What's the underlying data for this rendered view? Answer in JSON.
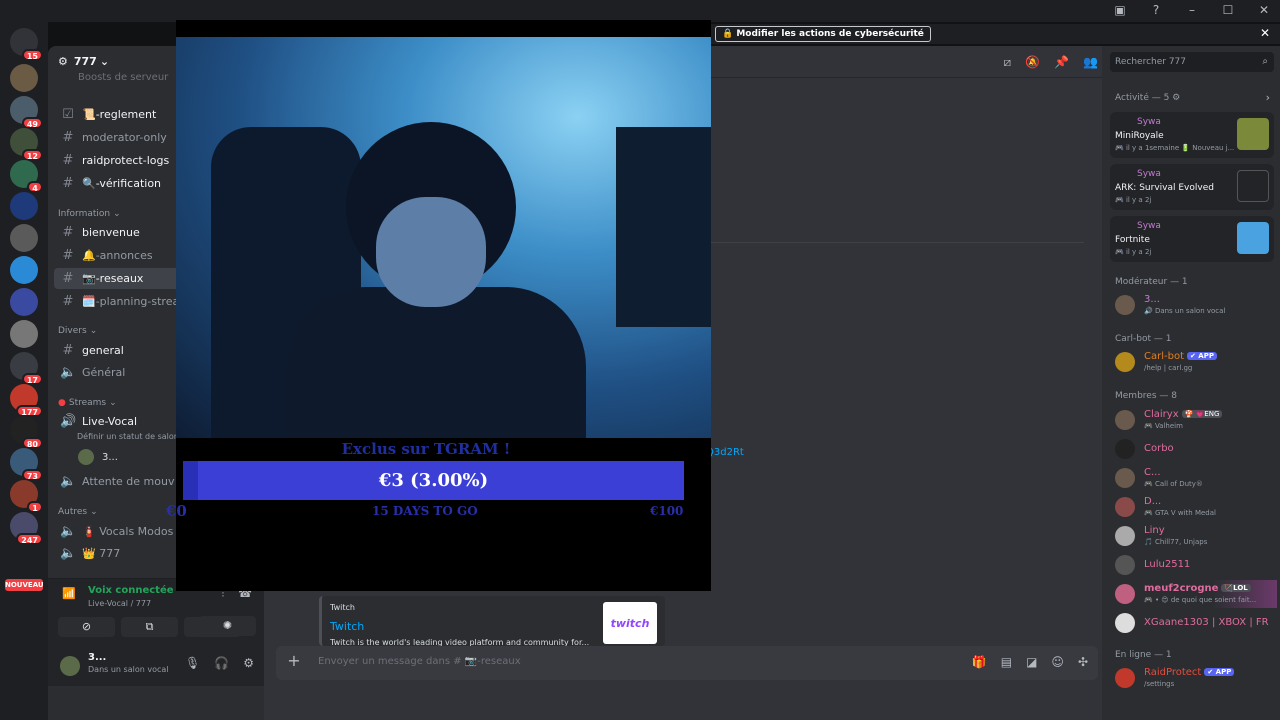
{
  "server": {
    "name": "777",
    "boosts_label": "Boosts de serveur"
  },
  "channels": {
    "top": [
      {
        "label": "📜-reglement",
        "bright": true
      },
      {
        "label": "moderator-only",
        "bright": false
      },
      {
        "label": "raidprotect-logs",
        "bright": true
      },
      {
        "label": "🔍-vérification",
        "bright": true
      }
    ],
    "cat_information": "Information",
    "information": [
      {
        "label": "bienvenue",
        "bright": true
      },
      {
        "label": "🔔-annonces",
        "bright": false
      },
      {
        "label": "📷-reseaux",
        "bright": true,
        "selected": true
      },
      {
        "label": "🗓️-planning-streams",
        "bright": false
      }
    ],
    "cat_divers": "Divers",
    "divers": [
      {
        "label": "general",
        "bright": true
      },
      {
        "label": "Général",
        "bright": false
      }
    ],
    "cat_streams": "Streams",
    "live_vocal": "Live-Vocal",
    "live_vocal_status": "Définir un statut de salon",
    "live_vocal_user": "3...",
    "attente": "Attente de mouv",
    "cat_autres": "Autres",
    "autres": [
      {
        "label": "🧯 Vocals Modos"
      },
      {
        "label": "👑 777"
      }
    ]
  },
  "rail": {
    "badges": [
      "15",
      "49",
      "12",
      "4",
      "17",
      "177",
      "80",
      "73",
      "1",
      "247"
    ],
    "new_label": "NOUVEAU"
  },
  "voice_panel": {
    "title": "Voix connectée",
    "subtitle": "Live-Vocal / 777"
  },
  "user_panel": {
    "name": "3...",
    "status": "Dans un salon vocal"
  },
  "banner": {
    "button": "🔒 Modifier les actions de cybersécurité",
    "close": "✕"
  },
  "main": {
    "link_fragment": "Q3d2Rt",
    "embed": {
      "provider": "Twitch",
      "title": "Twitch",
      "description": "Twitch is the world's leading video platform and community for...",
      "thumb_text": "twitch"
    },
    "composer_placeholder": "Envoyer un message dans # 📷-reseaux"
  },
  "members": {
    "search_placeholder": "Rechercher 777",
    "activity_header": "Activité — 5 ⚙",
    "activities": [
      {
        "user": "Sywa",
        "game": "MiniRoyale",
        "time": "🎮 il y a 1semaine  🔋 Nouveau j...",
        "thumb": "#7a8a3a"
      },
      {
        "user": "Sywa",
        "game": "ARK: Survival Evolved",
        "time": "🎮 il y a 2j",
        "thumb": "#2b2d31"
      },
      {
        "user": "Sywa",
        "game": "Fortnite",
        "time": "🎮 il y a 2j",
        "thumb": "#4aa3e0"
      }
    ],
    "moderator_header": "Modérateur — 1",
    "moderator": {
      "name": "3...",
      "sub": "🔊 Dans un salon vocal"
    },
    "carlbot_header": "Carl-bot — 1",
    "carlbot": {
      "name": "Carl-bot",
      "tag": "✔ APP",
      "sub": "/help | carl.gg"
    },
    "members_header": "Membres — 8",
    "list": [
      {
        "name": "Clairyx",
        "extra": "🍄 💗ENG",
        "sub": "🎮 Valheim",
        "color": "#e06c9f"
      },
      {
        "name": "Corbo",
        "extra": "",
        "sub": "",
        "color": "#e06c9f"
      },
      {
        "name": "C...",
        "extra": "",
        "sub": "🎮 Call of Duty®",
        "color": "#e06c9f"
      },
      {
        "name": "D...",
        "extra": "",
        "sub": "🎮 GTA V with Medal",
        "color": "#e06c9f"
      },
      {
        "name": "Liny",
        "extra": "",
        "sub": "🎵 Chill77, Unjaps",
        "color": "#e06c9f"
      },
      {
        "name": "Lulu2511",
        "extra": "",
        "sub": "",
        "color": "#e06c9f"
      },
      {
        "name": "meuf2crogne",
        "extra": "🏹LOL",
        "sub": "🎮 • 😍 de quoi que soient fait...",
        "color": "#e06c9f"
      },
      {
        "name": "XGaane1303 | XBOX | FR",
        "extra": "",
        "sub": "",
        "color": "#e06c9f"
      }
    ],
    "online_header": "En ligne — 1",
    "online": {
      "name": "RaidProtect",
      "tag": "✔ APP",
      "sub": "/settings"
    }
  },
  "stream": {
    "goal_title": "Exclus sur TGRAM !",
    "goal_amount": "€3 (3.00%)",
    "goal_progress": 0.03,
    "goal_min": "€0",
    "goal_days": "15 DAYS TO GO",
    "goal_max": "€100"
  }
}
